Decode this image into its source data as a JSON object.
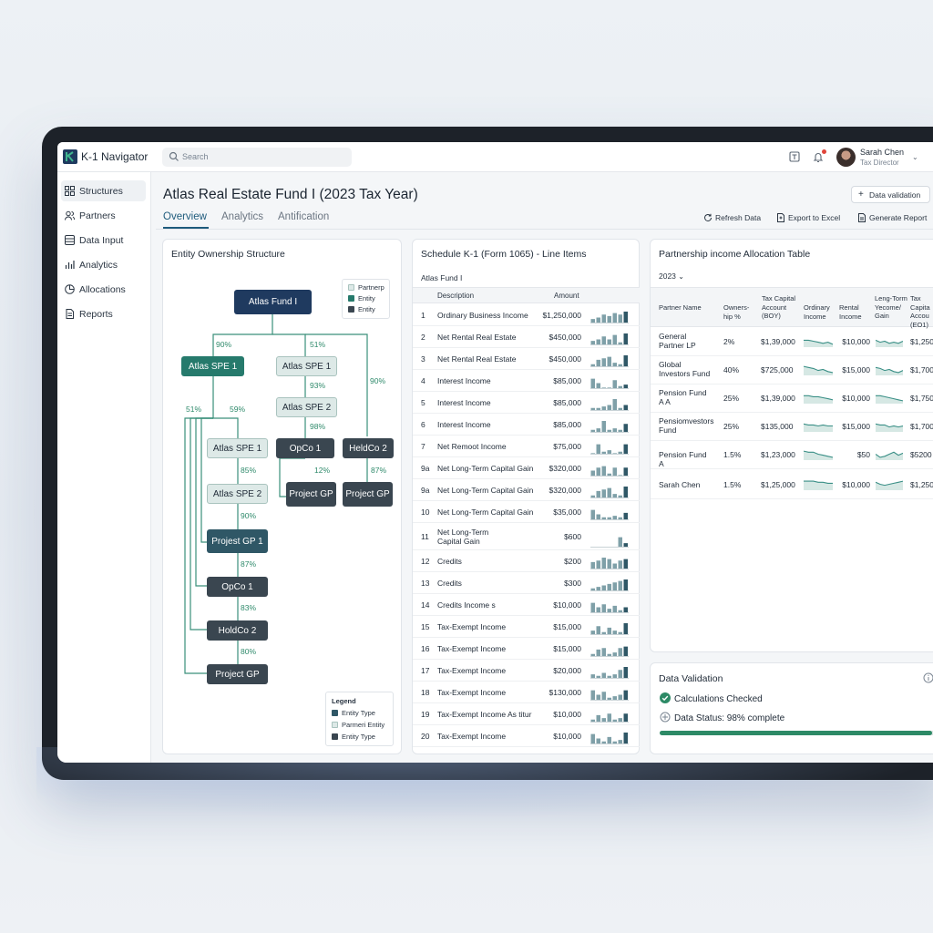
{
  "app": {
    "name": "K-1 Navigator"
  },
  "search": {
    "placeholder": "Search"
  },
  "user": {
    "name": "Sarah Chen",
    "role": "Tax Director"
  },
  "sidebar": {
    "items": [
      {
        "label": "Structures",
        "icon": "structures-icon",
        "active": true
      },
      {
        "label": "Partners",
        "icon": "partners-icon"
      },
      {
        "label": "Data Input",
        "icon": "data-input-icon"
      },
      {
        "label": "Analytics",
        "icon": "analytics-icon"
      },
      {
        "label": "Allocations",
        "icon": "allocations-icon"
      },
      {
        "label": "Reports",
        "icon": "reports-icon"
      }
    ]
  },
  "header": {
    "title": "Atlas Real Estate Fund I (2023 Tax Year)",
    "tabs": [
      "Overview",
      "Analytics",
      "Antification"
    ],
    "data_validation_btn": "Data validation",
    "actions": {
      "refresh": "Refresh Data",
      "export": "Export to Excel",
      "report": "Generate Report"
    }
  },
  "entity": {
    "title": "Entity Ownership Structure",
    "top_legend": [
      "Partnerp",
      "Entity",
      "Entity"
    ],
    "nodes": {
      "fund": "Atlas Fund I",
      "spe1_a": "Atlas SPE 1",
      "spe1_b": "Atlas SPE 1",
      "spe2_a": "Atlas SPE 2",
      "spe1_c": "Atlas SPE 1",
      "opco1_a": "OpCo 1",
      "holdco2_a": "HeldCo 2",
      "spe2_b": "Atlas SPE 2",
      "projgp_a": "Project GP",
      "projgp_b": "Project GP",
      "projgp1": "Projest GP 1",
      "opco1_b": "OpCo 1",
      "holdco2_b": "HoldCo 2",
      "projgp_c": "Project GP"
    },
    "percents": {
      "p1": "90%",
      "p2": "51%",
      "p3": "90%",
      "p4": "93%",
      "p5": "51%",
      "p6": "59%",
      "p7": "98%",
      "p8": "85%",
      "p9": "12%",
      "p10": "87%",
      "p11": "90%",
      "p12": "87%",
      "p13": "83%",
      "p14": "80%"
    },
    "legend": {
      "title": "Legend",
      "items": [
        "Entity Type",
        "Parmeri Entity",
        "Entity Type"
      ]
    }
  },
  "schedule": {
    "title": "Schedule K-1 (Form 1065) - Line Items",
    "fund": "Atlas Fund I",
    "columns": [
      "Description",
      "Amount"
    ],
    "rows": [
      {
        "num": "1",
        "desc": "Ordinary Business Income",
        "amount": "$1,250,000",
        "spark": [
          3,
          4,
          6,
          5,
          7,
          6,
          8
        ]
      },
      {
        "num": "2",
        "desc": "Net Rental Real Estate",
        "amount": "$450,000",
        "spark": [
          3,
          4,
          6,
          4,
          7,
          2,
          8
        ]
      },
      {
        "num": "3",
        "desc": "Net Rental Real Estate",
        "amount": "$450,000",
        "spark": [
          2,
          5,
          6,
          7,
          3,
          2,
          8
        ]
      },
      {
        "num": "4",
        "desc": "Interest Income",
        "amount": "$85,000",
        "spark": [
          7,
          4,
          1,
          1,
          6,
          2,
          3
        ]
      },
      {
        "num": "5",
        "desc": "Interest Income",
        "amount": "$85,000",
        "spark": [
          2,
          2,
          3,
          4,
          8,
          2,
          4
        ]
      },
      {
        "num": "6",
        "desc": "Interest Income",
        "amount": "$85,000",
        "spark": [
          2,
          3,
          8,
          2,
          3,
          2,
          6
        ]
      },
      {
        "num": "7",
        "desc": "Net Remoot Income",
        "amount": "$75,000",
        "spark": [
          1,
          7,
          2,
          3,
          1,
          2,
          7
        ]
      },
      {
        "num": "9a",
        "desc": "Net Long-Term Capital Gain",
        "amount": "$320,000",
        "spark": [
          4,
          6,
          7,
          2,
          6,
          1,
          6
        ]
      },
      {
        "num": "9a",
        "desc": "Net Long-Term Capital Gain",
        "amount": "$320,000",
        "spark": [
          2,
          5,
          6,
          7,
          3,
          2,
          8
        ]
      },
      {
        "num": "10",
        "desc": "Net Long-Term Capital Gain",
        "amount": "$35,000",
        "spark": [
          7,
          4,
          2,
          2,
          3,
          2,
          5
        ]
      },
      {
        "num": "11",
        "desc": "Net Long-Term Capital Gain",
        "amount": "$600",
        "spark": [
          0,
          0,
          0,
          0,
          0,
          7,
          3
        ]
      },
      {
        "num": "12",
        "desc": "Credits",
        "amount": "$200",
        "spark": [
          5,
          6,
          8,
          7,
          4,
          6,
          7
        ]
      },
      {
        "num": "13",
        "desc": "Credits",
        "amount": "$300",
        "spark": [
          2,
          3,
          4,
          5,
          6,
          7,
          8
        ]
      },
      {
        "num": "14",
        "desc": "Credits Income s",
        "amount": "$10,000",
        "spark": [
          7,
          4,
          6,
          3,
          5,
          2,
          4
        ]
      },
      {
        "num": "15",
        "desc": "Tax-Exempt Income",
        "amount": "$15,000",
        "spark": [
          3,
          6,
          2,
          5,
          3,
          2,
          8
        ]
      },
      {
        "num": "16",
        "desc": "Tax-Exempt Income",
        "amount": "$15,000",
        "spark": [
          2,
          5,
          6,
          2,
          3,
          6,
          7
        ]
      },
      {
        "num": "17",
        "desc": "Tax-Exempt Income",
        "amount": "$20,000",
        "spark": [
          3,
          2,
          4,
          2,
          3,
          6,
          8
        ]
      },
      {
        "num": "18",
        "desc": "Tax-Exempt Income",
        "amount": "$130,000",
        "spark": [
          7,
          4,
          6,
          2,
          3,
          4,
          7
        ]
      },
      {
        "num": "19",
        "desc": "Tax-Exempt Income As titur",
        "amount": "$10,000",
        "spark": [
          2,
          5,
          3,
          6,
          2,
          3,
          6
        ]
      },
      {
        "num": "20",
        "desc": "Tax-Exempt Income",
        "amount": "$10,000",
        "spark": [
          7,
          4,
          2,
          5,
          2,
          3,
          8
        ]
      }
    ]
  },
  "allocation": {
    "title": "Partnership income Allocation Table",
    "year": "2023",
    "columns": [
      "Partner Name",
      "Owners-hip %",
      "Tax Capital Account (BOY)",
      "Ordinary Income",
      "Rental Income",
      "Leng-Torm Yecome/ Gain",
      "Tax Capita Accou (EO1)"
    ],
    "rows": [
      {
        "name": "General Partner LP",
        "own": "2%",
        "capital": "$1,39,000",
        "rental": "$10,000",
        "eoy": "$1,250",
        "s1": [
          5,
          5,
          4,
          3,
          2,
          3,
          1
        ],
        "s2": [
          5,
          3,
          4,
          2,
          3,
          2,
          4
        ]
      },
      {
        "name": "Global Investors Fund",
        "own": "40%",
        "capital": "$725,000",
        "rental": "$15,000",
        "eoy": "$1,700",
        "s1": [
          7,
          6,
          5,
          3,
          4,
          2,
          1
        ],
        "s2": [
          6,
          5,
          3,
          4,
          2,
          1,
          3
        ]
      },
      {
        "name": "Pension Fund A A",
        "own": "25%",
        "capital": "$1,39,000",
        "rental": "$10,000",
        "eoy": "$1,750",
        "s1": [
          6,
          6,
          5,
          5,
          4,
          3,
          2
        ],
        "s2": [
          6,
          6,
          5,
          4,
          3,
          2,
          1
        ]
      },
      {
        "name": "Pensiomvestors Fund",
        "own": "25%",
        "capital": "$135,000",
        "rental": "$15,000",
        "eoy": "$1,700",
        "s1": [
          6,
          5,
          5,
          4,
          5,
          4,
          4
        ],
        "s2": [
          6,
          5,
          5,
          3,
          4,
          3,
          4
        ]
      },
      {
        "name": "Pension Fund A",
        "own": "1.5%",
        "capital": "$1,23,000",
        "rental": "$50",
        "eoy": "$5200",
        "s1": [
          7,
          6,
          6,
          4,
          3,
          2,
          1
        ],
        "s2": [
          4,
          1,
          2,
          4,
          6,
          3,
          5
        ]
      },
      {
        "name": "Sarah Chen",
        "own": "1.5%",
        "capital": "$1,25,000",
        "rental": "$10,000",
        "eoy": "$1,250",
        "s1": [
          7,
          7,
          7,
          6,
          6,
          5,
          5
        ],
        "s2": [
          6,
          4,
          3,
          4,
          5,
          6,
          7
        ]
      }
    ]
  },
  "validation": {
    "title": "Data Validation",
    "checked": "Calculations Checked",
    "status": "Data Status: 98% complete",
    "progress": 0.98
  },
  "colors": {
    "accent": "#1e5b7c",
    "teal": "#267a6c",
    "navy": "#1f3a5f",
    "green": "#2d8a66"
  }
}
